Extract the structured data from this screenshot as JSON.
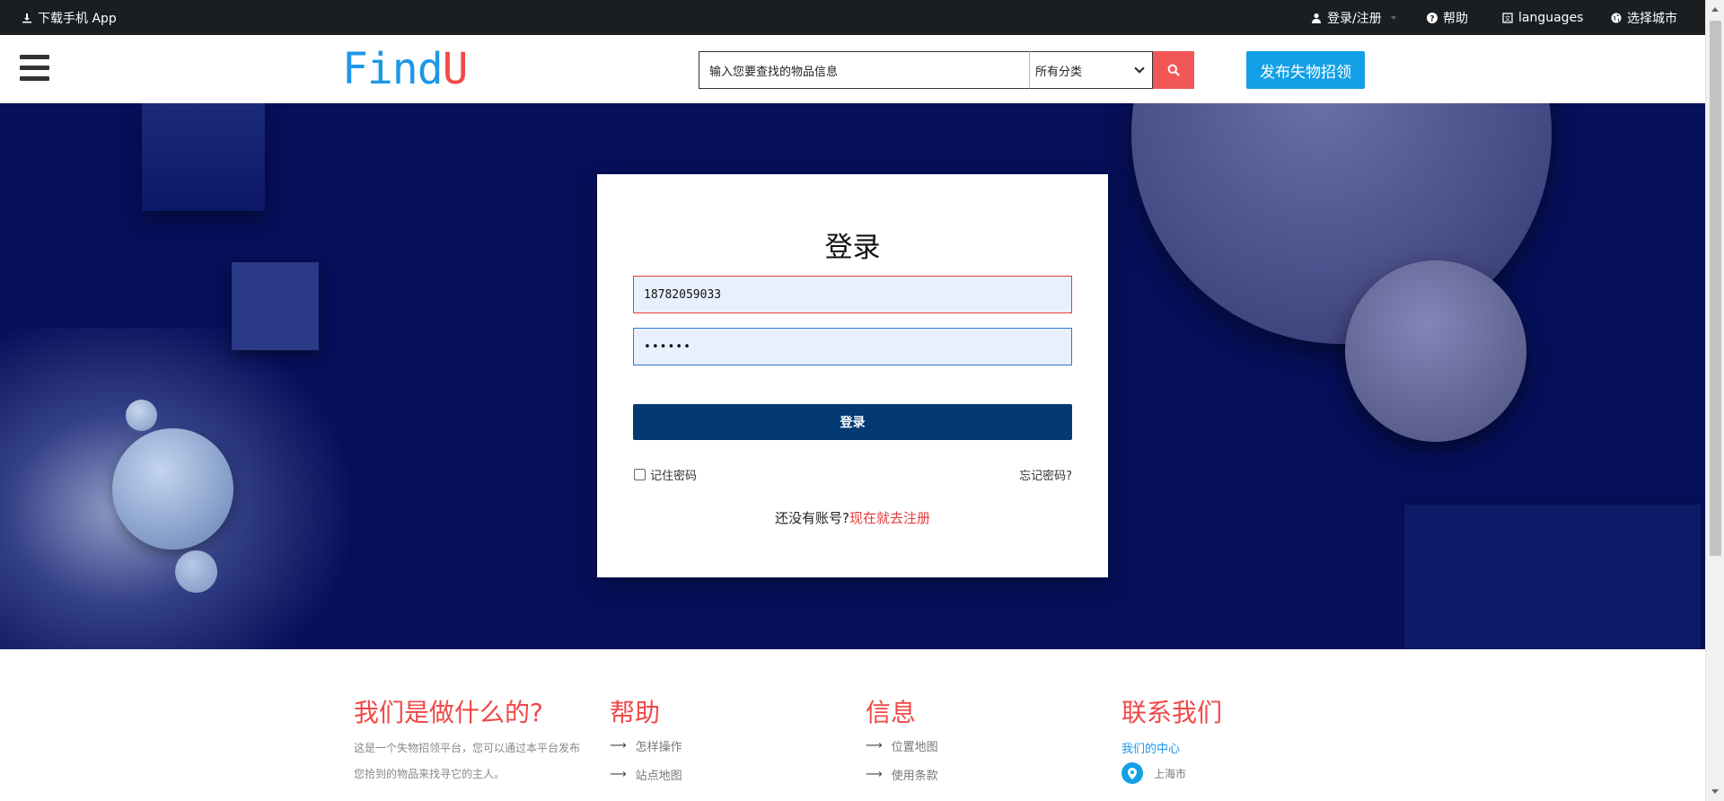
{
  "topbar": {
    "download_app": "下载手机 App",
    "login_register": "登录/注册",
    "help": "帮助",
    "languages": "languages",
    "choose_city": "选择城市"
  },
  "header": {
    "logo_part1": "Find",
    "logo_part2": "U",
    "search_placeholder": "输入您要查找的物品信息",
    "category_selected": "所有分类",
    "post_button": "发布失物招领"
  },
  "login": {
    "title": "登录",
    "username_value": "18782059033",
    "password_masked": "••••••",
    "submit_label": "登录",
    "remember_label": "记住密码",
    "forgot_label": "忘记密码?",
    "no_account_text": "还没有账号?",
    "register_link": "现在就去注册"
  },
  "footer": {
    "about": {
      "title": "我们是做什么的?",
      "text": "这是一个失物招领平台，您可以通过本平台发布您拾到的物品来找寻它的主人。"
    },
    "help": {
      "title": "帮助",
      "links": [
        "怎样操作",
        "站点地图"
      ]
    },
    "info": {
      "title": "信息",
      "links": [
        "位置地图",
        "使用条款"
      ]
    },
    "contact": {
      "title": "联系我们",
      "center": "我们的中心",
      "city": "上海市"
    }
  },
  "colors": {
    "topbar_bg": "#1a1e21",
    "hero_bg": "#06105a",
    "brand_blue": "#1e97e8",
    "brand_red": "#f24a4a",
    "login_button": "#043a73",
    "post_button": "#14a0e6"
  }
}
